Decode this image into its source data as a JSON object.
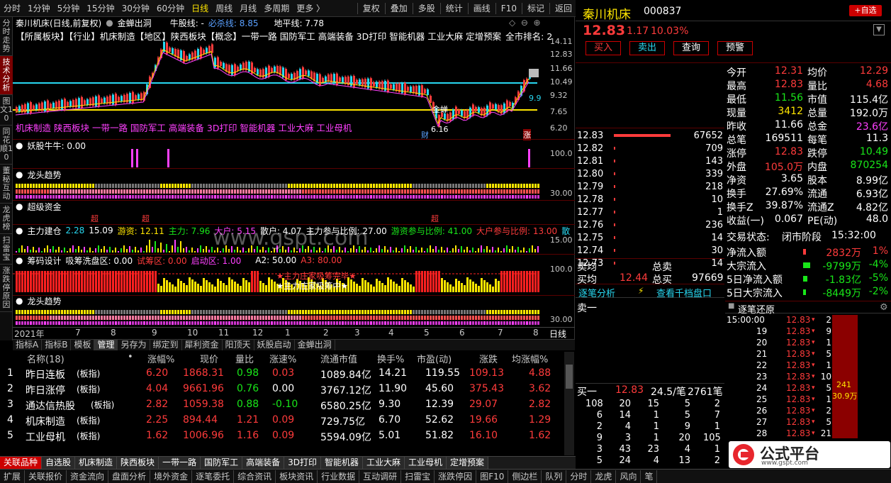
{
  "toolbar": {
    "left": [
      "分时",
      "1分钟",
      "5分钟",
      "15分钟",
      "30分钟",
      "60分钟",
      "日线",
      "周线",
      "月线",
      "多周期",
      "更多 〉"
    ],
    "active": 6,
    "right": [
      "复权",
      "叠加",
      "多股",
      "统计",
      "画线",
      "F10",
      "标记",
      "返回"
    ]
  },
  "vtabs": [
    "分时走势",
    "技术分析",
    "图文10",
    "同花顺10",
    "董秘互动",
    "龙虎榜",
    "扫雷宝",
    "涨跌停原因"
  ],
  "vtab_active": 1,
  "chart": {
    "title": "秦川机床(日线,前复权)",
    "indicator1": "金蝉出洞",
    "niugu": "牛股线: -",
    "bibei": "必杀线: 8.85",
    "diping": "地平线: 7.78",
    "concept_line": "【所属板块】【行业】机床制造【地区】陕西板块【概念】一带一路 国防军工 高端装备 3D打印 智能机器 工业大麻 定增预案",
    "rank": "全市排名: 2",
    "overlay_concepts": "机床制造 陕西板块 一带一路 国防军工 高端装备 3D打印 智能机器 工业大麻 工业母机",
    "mark_low": "6.16",
    "mark_cai": "财",
    "mark_zhang": "涨",
    "mark_jinchan": "金蝉",
    "price_mark": "9.9",
    "yticks": [
      "14.11",
      "12.83",
      "11.66",
      "10.49",
      "9.32",
      "7.65",
      "6.20"
    ],
    "p2_title": "妖股牛牛",
    "p2_val": "妖股牛牛: 0.00",
    "p2_y": "100.0",
    "p3_title": "龙头趋势",
    "p3_y": "30.00",
    "p4_title": "超级资金",
    "p4_mark": "超",
    "p5_title": "主力建仓",
    "p5_items": [
      "2.28",
      "15.09",
      "游资: 12.11",
      "主力: 7.96",
      "大户: 5.15",
      "散户: 4.07",
      "主力参与比例: 27.00",
      "游资参与比例: 41.00",
      "大户参与比例: 13.00",
      "散"
    ],
    "p5_y": "15.00",
    "p6_title": "筹码设计",
    "p6_items": [
      "吸筹洗盘区: 0.00",
      "试筹区: 0.00",
      "启动区: 1.00",
      "A2: 50.00",
      "A3: 80.00"
    ],
    "p6_text1": "★主力庄家吸筹中★",
    "p6_text2": "★主力庄家吸筹完毕★",
    "p6_y": "100.0",
    "p7_title": "龙头趋势",
    "p7_y": "30.00",
    "xaxis": [
      "2021年",
      "7",
      "8",
      "9",
      "10",
      "11",
      "12",
      "1",
      "2",
      "3",
      "4",
      "5",
      "6",
      "7",
      "8"
    ],
    "xaxis_right": "日线"
  },
  "bottom_tabs": [
    "指标A",
    "指标B",
    "模板",
    "管理",
    "另存为",
    "绑定到",
    "犀利资金",
    "阳顶天",
    "妖股启动",
    "金蝉出洞"
  ],
  "bottom_tab_active": 3,
  "table": {
    "headers": [
      "名称(18)",
      "涨幅%",
      "现价",
      "量比",
      "涨速%",
      "流通市值",
      "换手%",
      "市盈(动)",
      "涨跌",
      "均涨幅%"
    ],
    "rows": [
      {
        "n": "1",
        "name": "昨日连板",
        "tag": "(板指)",
        "zf": "6.20",
        "xj": "1868.31",
        "lb": "0.98",
        "zs": "0.03",
        "sz": "1089.84亿",
        "hs": "14.21",
        "sy": "119.55",
        "zd": "109.13",
        "jzf": "4.88",
        "zsc": "red"
      },
      {
        "n": "2",
        "name": "昨日涨停",
        "tag": "(板指)",
        "zf": "4.04",
        "xj": "9661.96",
        "lb": "0.76",
        "zs": "0.00",
        "sz": "3767.12亿",
        "hs": "11.90",
        "sy": "45.60",
        "zd": "375.43",
        "jzf": "3.62",
        "zsc": "wht"
      },
      {
        "n": "3",
        "name": "通达信热股",
        "tag": "(板指)",
        "zf": "2.82",
        "xj": "1059.38",
        "lb": "0.88",
        "zs": "-0.10",
        "sz": "6580.25亿",
        "hs": "9.30",
        "sy": "12.39",
        "zd": "29.07",
        "jzf": "2.82",
        "zsc": "grn"
      },
      {
        "n": "4",
        "name": "机床制造",
        "tag": "(板指)",
        "zf": "2.25",
        "xj": "894.44",
        "lb": "1.21",
        "zs": "0.09",
        "sz": "729.75亿",
        "hs": "6.70",
        "sy": "52.62",
        "zd": "19.66",
        "jzf": "1.29",
        "zsc": "red"
      },
      {
        "n": "5",
        "name": "工业母机",
        "tag": "(板指)",
        "zf": "1.62",
        "xj": "1006.96",
        "lb": "1.16",
        "zs": "0.09",
        "sz": "5594.09亿",
        "hs": "5.01",
        "sy": "51.82",
        "zd": "16.10",
        "jzf": "1.62",
        "zsc": "red"
      }
    ]
  },
  "sector_tabs": [
    "关联品种",
    "自选股",
    "机床制造",
    "陕西板块",
    "一带一路",
    "国防军工",
    "高端装备",
    "3D打印",
    "智能机器",
    "工业大麻",
    "工业母机",
    "定增预案"
  ],
  "bottombar": [
    "扩展",
    "关联报价",
    "资金流向",
    "盘面分析",
    "境外资金",
    "逐笔委托",
    "综合资讯",
    "板块资讯",
    "行业数据",
    "互动调研",
    "扫雷宝",
    "涨跌停因",
    "图F10",
    "侧边栏",
    "队列",
    "分时",
    "龙虎",
    "风向",
    "笔"
  ],
  "quote": {
    "name": "秦川机床",
    "code": "000837",
    "add_btn": "+自选",
    "price": "12.83",
    "chg": "1.17",
    "pct": "10.03%",
    "buttons": [
      "买入",
      "卖出",
      "查询",
      "预警"
    ],
    "fund_rows": [
      [
        "今开",
        "12.31",
        "red",
        "均价",
        "12.29",
        "red"
      ],
      [
        "最高",
        "12.83",
        "red",
        "量比",
        "4.68",
        "red"
      ],
      [
        "最低",
        "11.56",
        "grn",
        "市值",
        "115.4亿",
        "wht"
      ],
      [
        "现量",
        "3412",
        "yel",
        "总量",
        "192.0万",
        "wht"
      ],
      [
        "昨收",
        "11.66",
        "wht",
        "总金",
        "23.6亿",
        "mag"
      ],
      [
        "总笔",
        "169511",
        "wht",
        "每笔",
        "11.3",
        "wht"
      ],
      [
        "涨停",
        "12.83",
        "red",
        "跌停",
        "10.49",
        "grn"
      ],
      [
        "外盘",
        "105.0万",
        "red",
        "内盘",
        "870254",
        "grn"
      ],
      [
        "净资",
        "3.65",
        "wht",
        "股本",
        "8.99亿",
        "wht"
      ],
      [
        "换手",
        "27.69%",
        "wht",
        "流通",
        "6.93亿",
        "wht"
      ],
      [
        "换手Z",
        "39.87%",
        "wht",
        "流通Z",
        "4.82亿",
        "wht"
      ],
      [
        "收益(一)",
        "0.067",
        "wht",
        "PE(动)",
        "48.0",
        "wht"
      ]
    ],
    "status_label": "交易状态:",
    "status": "闭市阶段",
    "time": "15:32:00",
    "flow_rows": [
      [
        "净流入额",
        "2832万",
        "1%",
        "red"
      ],
      [
        "大宗流入",
        "-9799万",
        "-4%",
        "grn"
      ],
      [
        "5日净流入额",
        "-1.83亿",
        "-5%",
        "grn"
      ],
      [
        "5日大宗流入",
        "-8449万",
        "-2%",
        "grn"
      ]
    ],
    "orderbook": [
      [
        "12.83",
        "67652"
      ],
      [
        "12.82",
        "709"
      ],
      [
        "12.81",
        "143"
      ],
      [
        "12.80",
        "339"
      ],
      [
        "12.79",
        "218"
      ],
      [
        "12.78",
        "10"
      ],
      [
        "12.77",
        "1"
      ],
      [
        "12.76",
        "236"
      ],
      [
        "12.75",
        "14"
      ],
      [
        "12.74",
        "30"
      ],
      [
        "12.73",
        "14"
      ]
    ],
    "ob_labels": {
      "sell_avg": "卖均",
      "total_sell": "总卖",
      "buy_avg": "买均",
      "buy_avg_v": "12.44",
      "total_buy": "总买",
      "total_buy_v": "97669",
      "tab1": "逐笔分析",
      "tab2": "查看千档盘口",
      "sell1": "卖一",
      "buy1": "买一",
      "buy1_p": "12.83",
      "buy1_per": "24.5/笔",
      "buy1_v": "2761笔"
    },
    "buy_queue": [
      [
        "108",
        "20",
        "15",
        "5",
        "2"
      ],
      [
        "6",
        "14",
        "1",
        "5",
        "7"
      ],
      [
        "2",
        "4",
        "1",
        "9",
        "1"
      ],
      [
        "9",
        "3",
        "1",
        "20",
        "105"
      ],
      [
        "3",
        "43",
        "23",
        "4",
        "1"
      ],
      [
        "5",
        "24",
        "4",
        "13",
        "2"
      ]
    ],
    "trades_title": "逐笔还原",
    "trades": [
      [
        "15:00:00",
        "12.83",
        "2"
      ],
      [
        "19",
        "12.83",
        "9"
      ],
      [
        "20",
        "12.83",
        "1"
      ],
      [
        "21",
        "12.83",
        "5"
      ],
      [
        "22",
        "12.83",
        "1"
      ],
      [
        "23",
        "12.83",
        "10"
      ],
      [
        "24",
        "12.83",
        "5"
      ],
      [
        "25",
        "12.83",
        "1"
      ],
      [
        "26",
        "12.83",
        "2"
      ],
      [
        "27",
        "12.83",
        "5"
      ],
      [
        "28",
        "12.83",
        "21"
      ]
    ],
    "trade_bar_top": "241",
    "trade_bar_bot": "30.9万"
  },
  "logo": {
    "text": "公式平台",
    "url": "www.gspt.com",
    "watermark": "www.gspt.com"
  }
}
